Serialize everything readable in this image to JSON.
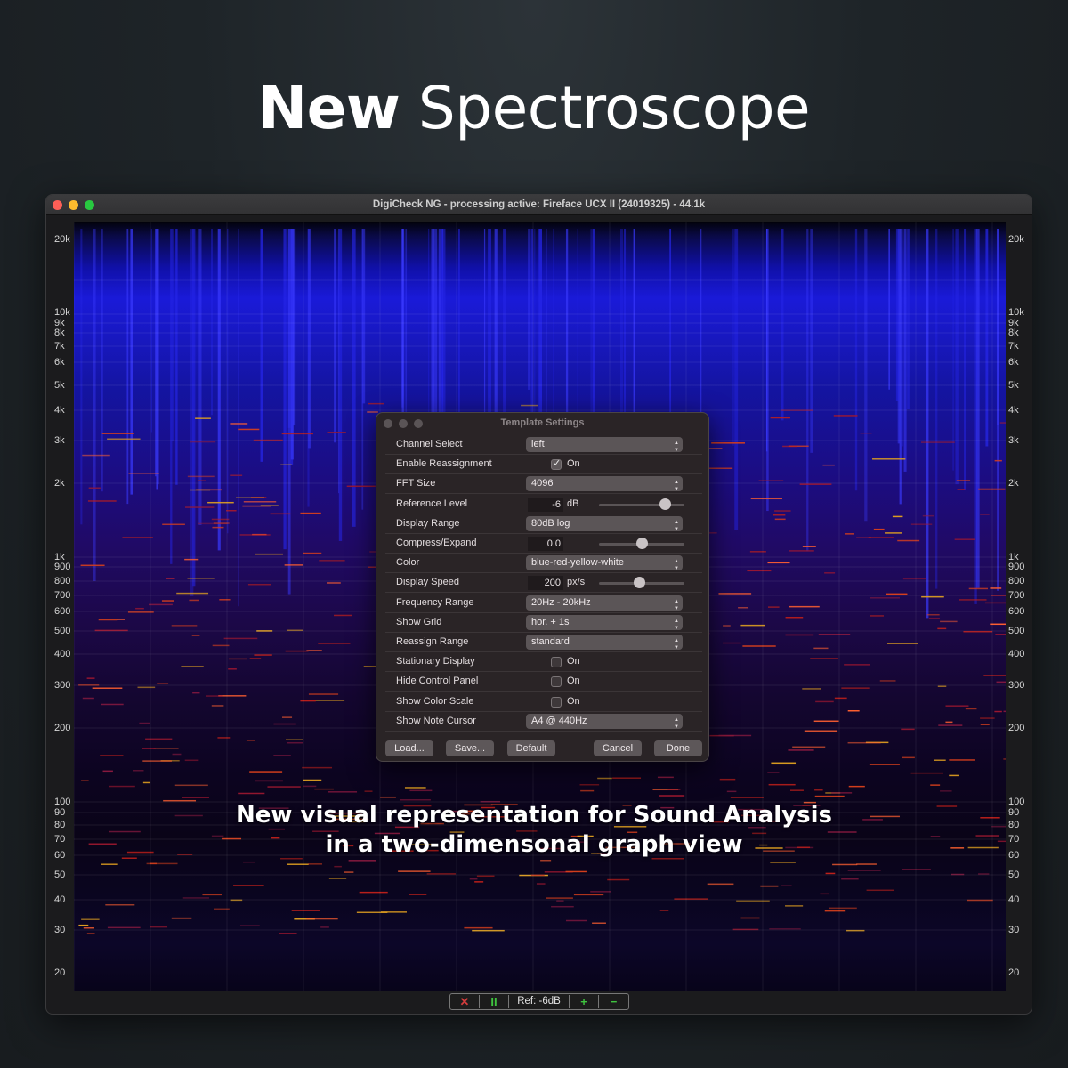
{
  "headline": {
    "bold": "New",
    "light": "Spectroscope"
  },
  "window": {
    "title": "DigiCheck NG - processing active: Fireface UCX II (24019325) - 44.1k"
  },
  "axis": {
    "labels": [
      "20k",
      "10k",
      "9k",
      "8k",
      "7k",
      "6k",
      "5k",
      "4k",
      "3k",
      "2k",
      "1k",
      "900",
      "800",
      "700",
      "600",
      "500",
      "400",
      "300",
      "200",
      "100",
      "90",
      "80",
      "70",
      "60",
      "50",
      "40",
      "30",
      "20"
    ]
  },
  "dialog": {
    "title": "Template Settings",
    "rows": [
      {
        "label": "Channel Select",
        "type": "dropdown",
        "value": "left"
      },
      {
        "label": "Enable Reassignment",
        "type": "checkbox",
        "checked": true,
        "text": "On"
      },
      {
        "label": "FFT Size",
        "type": "dropdown",
        "value": "4096"
      },
      {
        "label": "Reference Level",
        "type": "slider",
        "value": "-6",
        "unit": "dB",
        "level": 0.77
      },
      {
        "label": "Display Range",
        "type": "dropdown",
        "value": "80dB log"
      },
      {
        "label": "Compress/Expand",
        "type": "slider",
        "value": "0.0",
        "unit": "",
        "level": 0.5
      },
      {
        "label": "Color",
        "type": "dropdown",
        "value": "blue-red-yellow-white"
      },
      {
        "label": "Display Speed",
        "type": "slider",
        "value": "200",
        "unit": "px/s",
        "level": 0.47
      },
      {
        "label": "Frequency Range",
        "type": "dropdown",
        "value": "20Hz - 20kHz"
      },
      {
        "label": "Show Grid",
        "type": "dropdown",
        "value": "hor. + 1s"
      },
      {
        "label": "Reassign Range",
        "type": "dropdown",
        "value": "standard"
      },
      {
        "label": "Stationary Display",
        "type": "checkbox",
        "checked": false,
        "text": "On"
      },
      {
        "label": "Hide Control Panel",
        "type": "checkbox",
        "checked": false,
        "text": "On"
      },
      {
        "label": "Show Color Scale",
        "type": "checkbox",
        "checked": false,
        "text": "On"
      },
      {
        "label": "Show Note Cursor",
        "type": "dropdown",
        "value": "A4 @ 440Hz"
      }
    ],
    "buttons": {
      "load": "Load...",
      "save": "Save...",
      "default": "Default",
      "cancel": "Cancel",
      "done": "Done"
    }
  },
  "caption": {
    "line1": "New visual representation for Sound Analysis",
    "line2": "in a two-dimensonal graph view"
  },
  "toolbar": {
    "close": "✕",
    "pause": "II",
    "ref": "Ref: -6dB",
    "plus": "+",
    "minus": "−"
  },
  "colors": {
    "spectrogram_blue": "#1a1ad8",
    "spectrogram_red": "#c0201a",
    "accent_green": "#3fc43f"
  }
}
